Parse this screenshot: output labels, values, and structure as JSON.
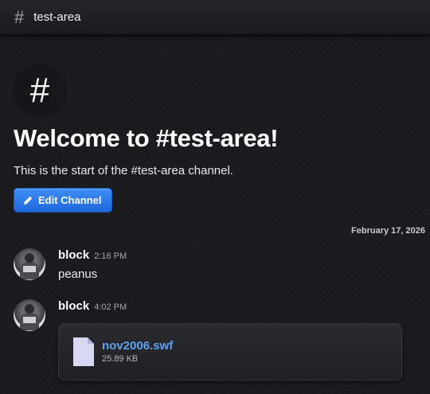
{
  "header": {
    "hash_symbol": "#",
    "channel_name": "test-area"
  },
  "intro": {
    "hash_symbol": "#",
    "welcome_title": "Welcome to #test-area!",
    "start_text": "This is the start of the #test-area channel.",
    "edit_button_label": "Edit Channel",
    "edit_icon": "pencil-icon"
  },
  "date_separator": "February 17, 2026",
  "messages": [
    {
      "author": "block",
      "time": "2:16 PM",
      "text": "peanus"
    },
    {
      "author": "block",
      "time": "4:02 PM",
      "attachment": {
        "icon": "file-icon",
        "filename": "nov2006.swf",
        "size": "25.89 KB"
      }
    }
  ],
  "colors": {
    "accent_button": "#2f7bea",
    "link": "#5ea3f3",
    "background": "#1b1c1f"
  }
}
